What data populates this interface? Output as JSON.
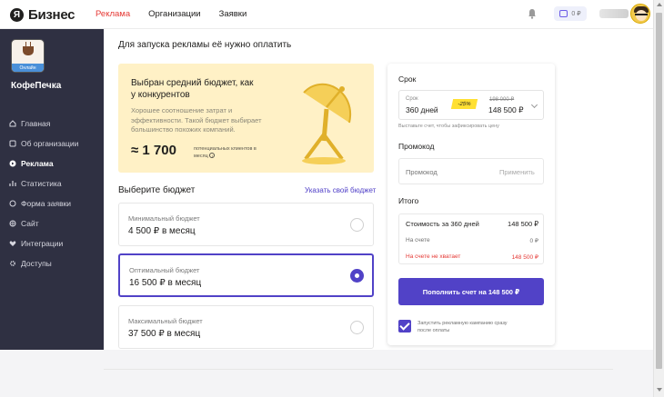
{
  "header": {
    "logo_letter": "Я",
    "logo_text": "Бизнес",
    "nav": [
      {
        "label": "Реклама",
        "active": true
      },
      {
        "label": "Организации",
        "active": false
      },
      {
        "label": "Заявки",
        "active": false
      }
    ],
    "wallet_value": "0 ₽"
  },
  "sidebar": {
    "org_badge": "Онлайн",
    "org_name": "КофеПечка",
    "items": [
      {
        "label": "Главная",
        "icon": "home-icon"
      },
      {
        "label": "Об организации",
        "icon": "info-card-icon"
      },
      {
        "label": "Реклама",
        "icon": "ad-icon",
        "active": true
      },
      {
        "label": "Статистика",
        "icon": "stats-icon"
      },
      {
        "label": "Форма заявки",
        "icon": "chat-icon"
      },
      {
        "label": "Сайт",
        "icon": "globe-icon"
      },
      {
        "label": "Интеграции",
        "icon": "heart-icon"
      },
      {
        "label": "Доступы",
        "icon": "gear-icon"
      }
    ]
  },
  "main": {
    "title": "Для запуска рекламы её нужно оплатить",
    "promo": {
      "title": "Выбран средний бюджет, как у конкурентов",
      "description": "Хорошее соотношение затрат и эффективности. Такой бюджет выбирает большинство похожих компаний.",
      "number": "≈ 1 700",
      "number_caption": "потенциальных клиентов в месяц"
    },
    "budget_title": "Выберите бюджет",
    "budget_link": "Указать свой бюджет",
    "options": [
      {
        "label": "Минимальный бюджет",
        "value": "4 500 ₽ в месяц",
        "selected": false
      },
      {
        "label": "Оптимальный бюджет",
        "value": "16 500 ₽ в месяц",
        "selected": true
      },
      {
        "label": "Максимальный бюджет",
        "value": "37 500 ₽ в месяц",
        "selected": false
      }
    ]
  },
  "panel": {
    "term_title": "Срок",
    "term_label": "Срок",
    "term_value": "360 дней",
    "discount_badge": "-25%",
    "old_price": "198 000 ₽",
    "new_price": "148 500 ₽",
    "term_hint": "Выставьте счет, чтобы зафиксировать цену",
    "promo_title": "Промокод",
    "promo_placeholder": "Промокод",
    "promo_apply": "Применить",
    "total_title": "Итого",
    "total_rows": [
      {
        "label": "Стоимость за 360 дней",
        "value": "148 500 ₽"
      },
      {
        "label": "На счете",
        "value": "0 ₽"
      },
      {
        "label": "На счете не хватает",
        "value": "148 500 ₽"
      }
    ],
    "pay_button": "Пополнить счет на 148 500 ₽",
    "checkbox_checked": true,
    "checkbox_label": "Запустить рекламную кампанию сразу после оплаты"
  },
  "colors": {
    "accent": "#5142c7",
    "sidebar_bg": "#2f3042",
    "promo_bg": "#fff1c6",
    "nav_active": "#e53935",
    "discount": "#ffe033"
  }
}
